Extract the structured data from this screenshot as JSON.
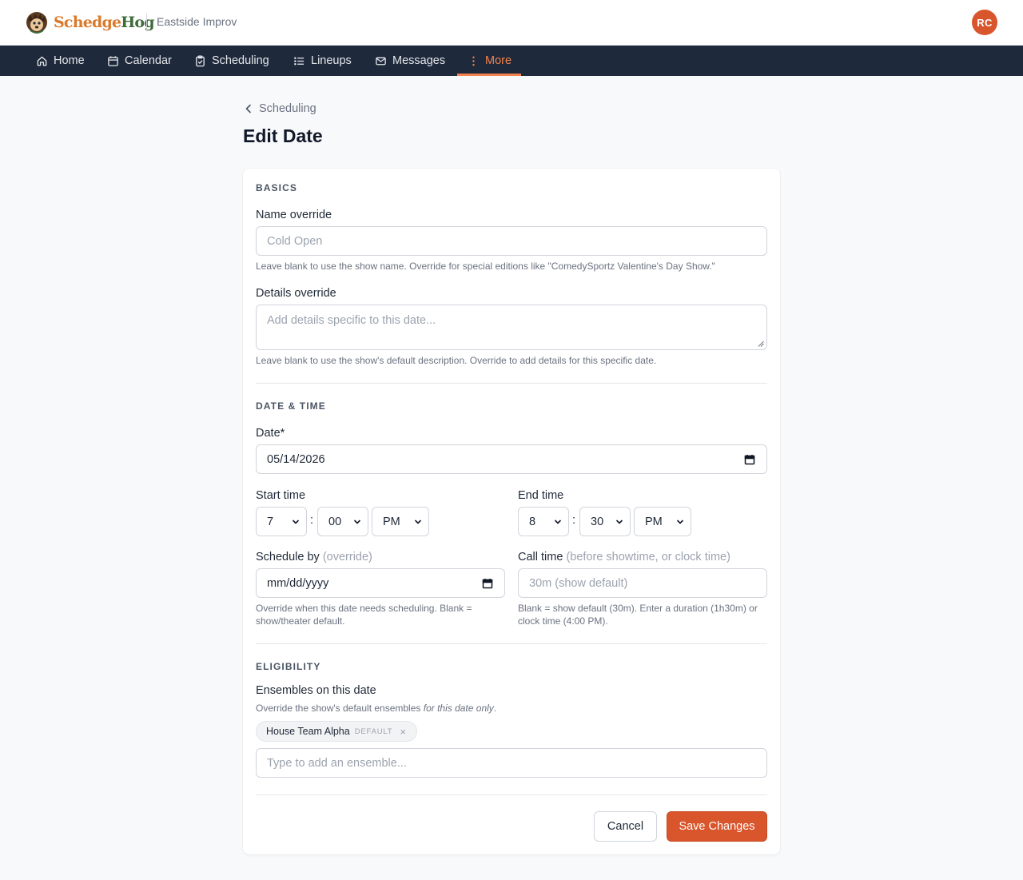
{
  "header": {
    "logo_part1": "Schedge",
    "logo_part2": "Hog",
    "org_name": "Eastside Improv",
    "avatar_initials": "RC"
  },
  "nav": {
    "items": [
      {
        "label": "Home",
        "icon": "home-icon"
      },
      {
        "label": "Calendar",
        "icon": "calendar-icon"
      },
      {
        "label": "Scheduling",
        "icon": "clipboard-check-icon"
      },
      {
        "label": "Lineups",
        "icon": "list-icon"
      },
      {
        "label": "Messages",
        "icon": "mail-icon"
      },
      {
        "label": "More",
        "icon": "more-vertical-icon",
        "active": true
      }
    ]
  },
  "breadcrumb": {
    "back_label": "Scheduling"
  },
  "page": {
    "title": "Edit Date"
  },
  "basics": {
    "heading": "BASICS",
    "name_label": "Name override",
    "name_placeholder": "Cold Open",
    "name_help": "Leave blank to use the show name. Override for special editions like \"ComedySportz Valentine's Day Show.\"",
    "details_label": "Details override",
    "details_placeholder": "Add details specific to this date...",
    "details_help": "Leave blank to use the show's default description. Override to add details for this specific date."
  },
  "datetime": {
    "heading": "DATE & TIME",
    "date_label": "Date*",
    "date_value": "05/14/2026",
    "start_label": "Start time",
    "start_hour": "7",
    "start_minute": "00",
    "start_period": "PM",
    "end_label": "End time",
    "end_hour": "8",
    "end_minute": "30",
    "end_period": "PM",
    "colon": ":",
    "schedule_label": "Schedule by",
    "schedule_label_note": "(override)",
    "schedule_value": "mm/dd/yyyy",
    "schedule_help": "Override when this date needs scheduling. Blank = show/theater default.",
    "call_label": "Call time",
    "call_label_note": "(before showtime, or clock time)",
    "call_placeholder": "30m (show default)",
    "call_help": "Blank = show default (30m). Enter a duration (1h30m) or clock time (4:00 PM)."
  },
  "eligibility": {
    "heading": "ELIGIBILITY",
    "ensembles_label": "Ensembles on this date",
    "ensembles_help_before": "Override the show's default ensembles ",
    "ensembles_help_em": "for this date only",
    "ensembles_help_after": ".",
    "chip_name": "House Team Alpha",
    "chip_tag": "DEFAULT",
    "chip_remove": "×",
    "ensemble_placeholder": "Type to add an ensemble..."
  },
  "actions": {
    "cancel_label": "Cancel",
    "save_label": "Save Changes"
  },
  "colors": {
    "accent": "#d9552b",
    "nav_bg": "#1e293b",
    "nav_active": "#f0834f"
  }
}
